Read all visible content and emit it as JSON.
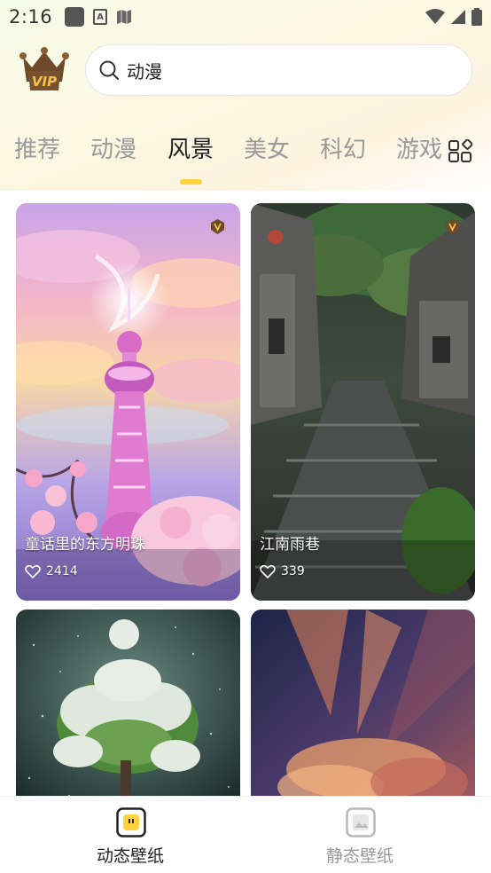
{
  "status_bar": {
    "time": "2:16",
    "icons": [
      "app-icon",
      "font-icon",
      "map-icon",
      "wifi-icon",
      "signal-icon",
      "battery-icon"
    ]
  },
  "header": {
    "vip_badge_text": "VIP",
    "search": {
      "value": "动漫",
      "icon": "search-icon"
    }
  },
  "tabs": {
    "items": [
      {
        "label": "推荐"
      },
      {
        "label": "动漫"
      },
      {
        "label": "风景"
      },
      {
        "label": "美女"
      },
      {
        "label": "科幻"
      },
      {
        "label": "游戏"
      }
    ],
    "active_index": 2,
    "accent_color": "#ffd33d",
    "more_icon": "grid-icon"
  },
  "cards": [
    {
      "title": "童话里的东方明珠",
      "likes": "2414",
      "vip": true
    },
    {
      "title": "江南雨巷",
      "likes": "339",
      "vip": true
    },
    {
      "title": "",
      "likes": "",
      "vip": false
    },
    {
      "title": "",
      "likes": "",
      "vip": false
    }
  ],
  "bottom_nav": {
    "items": [
      {
        "label": "动态壁纸",
        "icon": "dynamic-wallpaper-icon",
        "active": true,
        "color": "#222222"
      },
      {
        "label": "静态壁纸",
        "icon": "static-wallpaper-icon",
        "active": false,
        "color": "#999999"
      }
    ]
  }
}
